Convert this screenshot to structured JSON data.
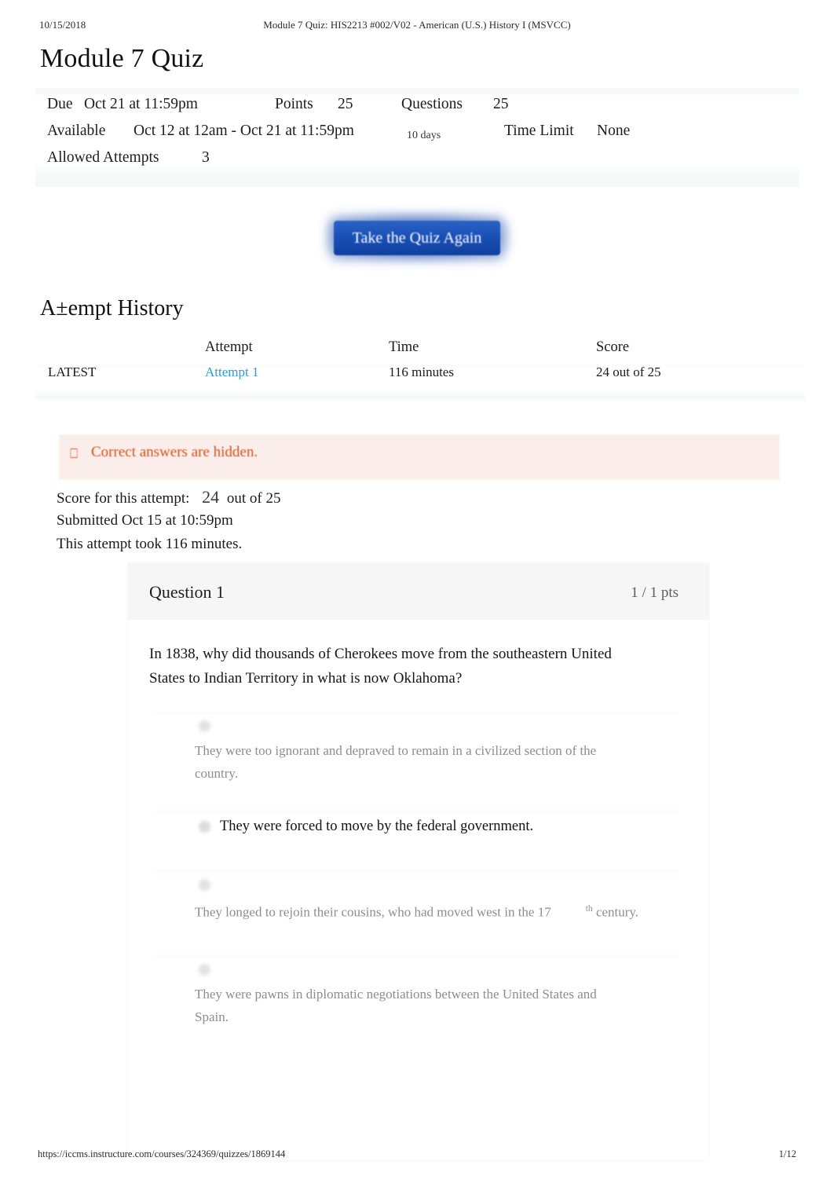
{
  "print": {
    "date": "10/15/2018",
    "header_title": "Module 7 Quiz: HIS2213 #002/V02 - American (U.S.) History I (MSVCC)",
    "footer_url": "https://iccms.instructure.com/courses/324369/quizzes/1869144",
    "footer_page": "1/12"
  },
  "page_title": "Module 7 Quiz",
  "quiz_details": {
    "due_label": "Due",
    "due_value": "Oct 21 at 11:59pm",
    "points_label": "Points",
    "points_value": "25",
    "questions_label": "Questions",
    "questions_value": "25",
    "available_label": "Available",
    "available_value": "Oct 12 at 12am - Oct 21 at 11:59pm",
    "available_duration": "10 days",
    "time_limit_label": "Time Limit",
    "time_limit_value": "None",
    "allowed_attempts_label": "Allowed Attempts",
    "allowed_attempts_value": "3"
  },
  "take_quiz_button": "Take the Quiz Again",
  "attempt_history": {
    "heading": "A±empt History",
    "columns": [
      "",
      "Attempt",
      "Time",
      "Score"
    ],
    "rows": [
      {
        "badge": "LATEST",
        "attempt": "Attempt 1",
        "time": "116 minutes",
        "score": "24 out of 25"
      }
    ]
  },
  "hidden_answers_banner": {
    "icon": "warning-box-icon",
    "icon_glyph": "⎕",
    "text": "Correct answers are hidden."
  },
  "attempt_summary": {
    "score_label": "Score for this attempt:",
    "score_value": "24",
    "score_outof": "out of 25",
    "submitted": "Submitted Oct 15 at 10:59pm",
    "duration": "This attempt took 116 minutes."
  },
  "question": {
    "name": "Question 1",
    "points": "1 / 1 pts",
    "text": "In 1838, why did thousands of Cherokees move from the southeastern United States to Indian Territory in what is now Oklahoma?",
    "answers": [
      {
        "text": "They were too ignorant and depraved to remain in a civilized section of the country.",
        "selected": false,
        "suffix": ""
      },
      {
        "text": "They were forced to move by the federal government.",
        "selected": true,
        "suffix": ""
      },
      {
        "text": "They longed to rejoin their cousins, who had moved west in the 17",
        "selected": false,
        "suffix_sup": "th",
        "suffix": "century."
      },
      {
        "text": "They were pawns in diplomatic negotiations between the United States and Spain.",
        "selected": false,
        "suffix": ""
      }
    ]
  },
  "colors": {
    "link": "#2b9ad6",
    "warning_text": "#d1521f",
    "warning_bg": "#fbeeea",
    "button_bg": "#1950b6",
    "card_header_bg": "#f6f6f6"
  }
}
